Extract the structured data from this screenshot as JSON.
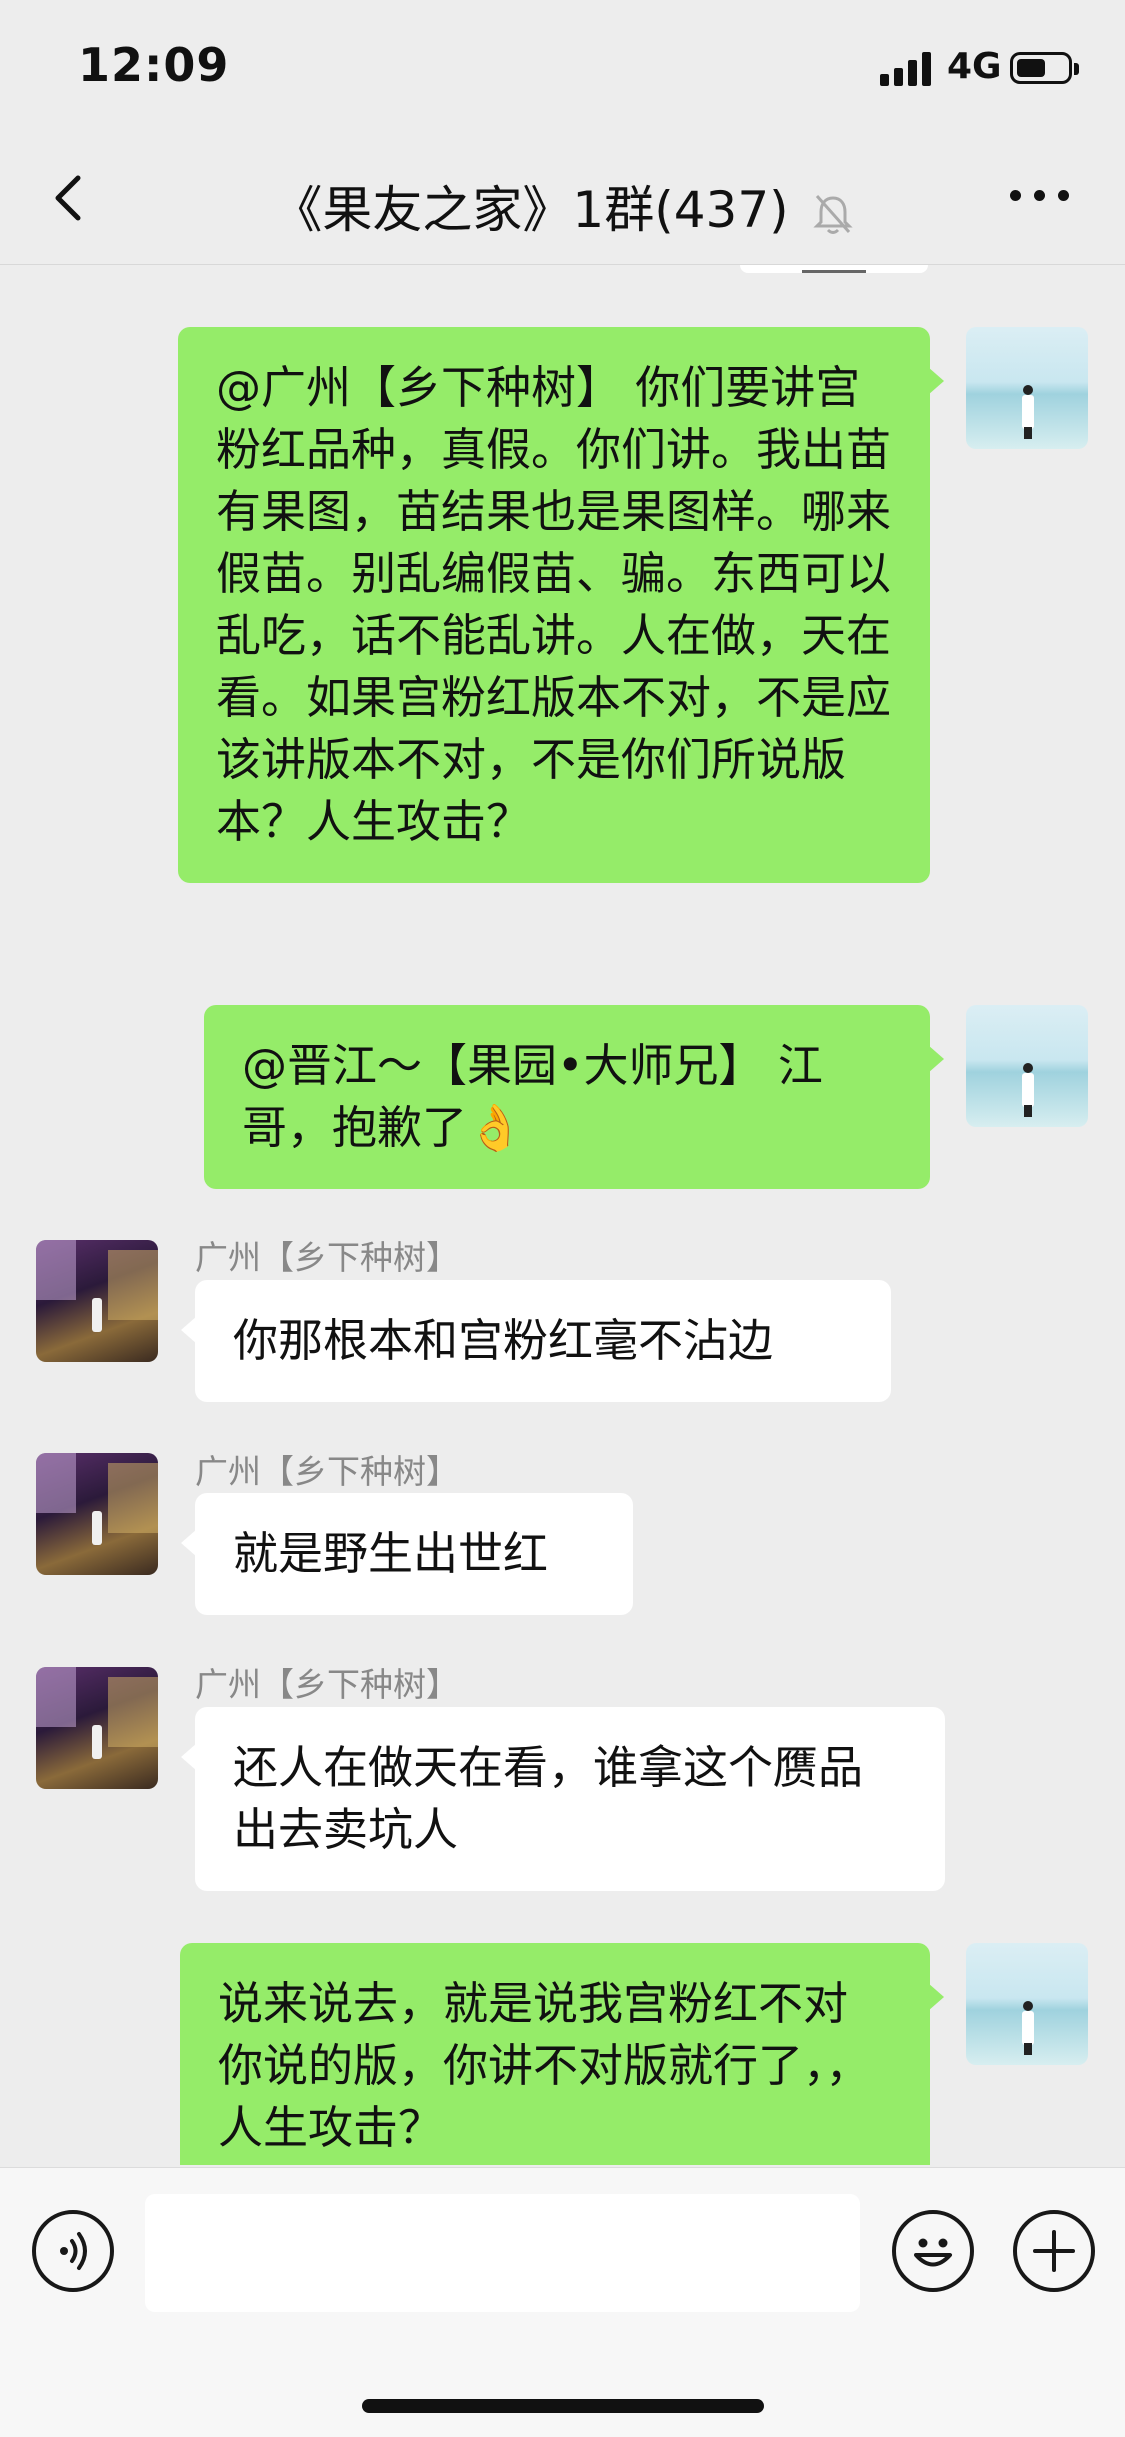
{
  "status_bar": {
    "time": "12:09",
    "network": "4G"
  },
  "header": {
    "back_icon": "chevron-left-icon",
    "title": "《果友之家》1群(437)",
    "mute_icon": "bell-off-icon",
    "more_icon": "ellipsis-icon"
  },
  "messages": [
    {
      "side": "right",
      "text": "@广州【乡下种树】 你们要讲宫粉红品种，真假。你们讲。我出苗有果图，苗结果也是果图样。哪来假苗。别乱编假苗、骗。东西可以乱吃，话不能乱讲。人在做，天在看。如果宫粉红版本不对，不是应该讲版本不对，不是你们所说版本？人生攻击？"
    },
    {
      "side": "right",
      "text": "@晋江～【果园•大师兄】 江哥，抱歉了👌"
    },
    {
      "side": "left",
      "sender": "广州【乡下种树】",
      "text": "你那根本和宫粉红毫不沾边"
    },
    {
      "side": "left",
      "sender": "广州【乡下种树】",
      "text": "就是野生出世红"
    },
    {
      "side": "left",
      "sender": "广州【乡下种树】",
      "text": "还人在做天在看，谁拿这个赝品出去卖坑人"
    },
    {
      "side": "right",
      "text": "说来说去，就是说我宫粉红不对你说的版，你讲不对版就行了，，人生攻击？"
    }
  ],
  "input_bar": {
    "voice_icon": "voice-icon",
    "input_value": "",
    "emoji_icon": "emoji-icon",
    "plus_icon": "plus-icon"
  },
  "colors": {
    "background": "#ededed",
    "bubble_self": "#95ec69",
    "bubble_other": "#ffffff",
    "sender_name": "#888888"
  }
}
